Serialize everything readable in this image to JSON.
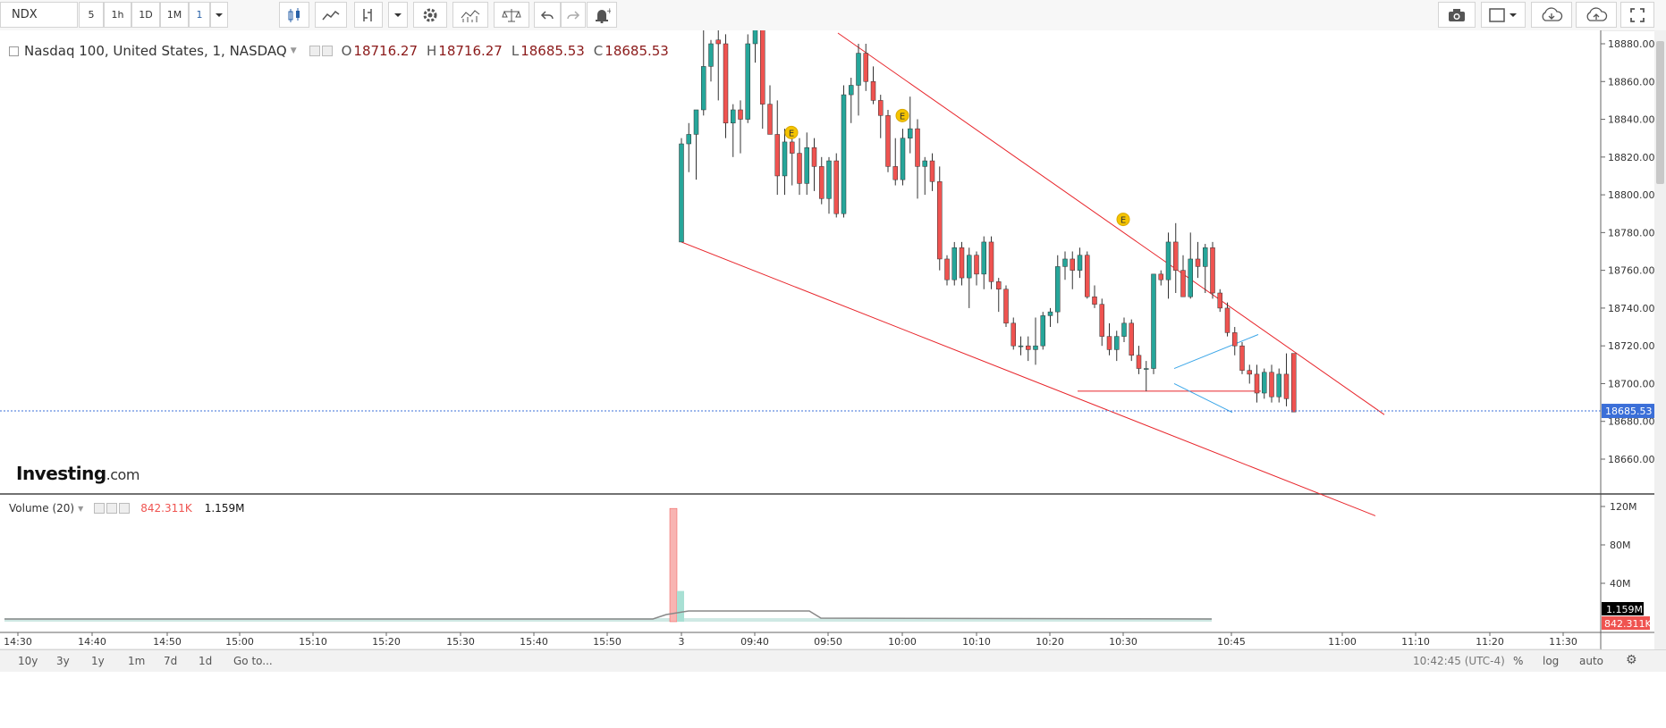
{
  "toolbar": {
    "symbol": "NDX",
    "intervals": [
      "5",
      "1h",
      "1D",
      "1M",
      "1"
    ],
    "active_interval": "1",
    "icons": [
      "candles-icon",
      "line-chart-icon",
      "drawing-tool-icon",
      "dropdown-icon",
      "settings-icon",
      "indicators-icon",
      "compare-icon",
      "undo-icon",
      "redo-icon",
      "alert-icon",
      "camera-icon",
      "layout-icon",
      "cloud-download-icon",
      "cloud-upload-icon",
      "fullscreen-icon"
    ]
  },
  "legend": {
    "name": "Nasdaq 100, United States, 1, NASDAQ",
    "open_label": "O",
    "open": "18716.27",
    "high_label": "H",
    "high": "18716.27",
    "low_label": "L",
    "low": "18685.53",
    "close_label": "C",
    "close": "18685.53"
  },
  "volume_legend": {
    "name": "Volume (20)",
    "value1": "842.311K",
    "value2": "1.159M"
  },
  "logo": {
    "brand": "Investing",
    "domain": ".com"
  },
  "bottom": {
    "ranges": [
      "10y",
      "3y",
      "1y",
      "1m",
      "7d",
      "1d"
    ],
    "goto": "Go to...",
    "time": "10:42:45 (UTC-4)",
    "pct": "%",
    "log": "log",
    "auto": "auto"
  },
  "colors": {
    "up": "#26a69a",
    "down": "#ef5350",
    "trendline": "#e8252b",
    "pattern": "#3ba6e8",
    "priceline": "#3b6fd8"
  },
  "chart_data": {
    "type": "candlestick",
    "ylim": [
      18645,
      18885
    ],
    "y_ticks": [
      18880,
      18860,
      18840,
      18820,
      18800,
      18780,
      18760,
      18740,
      18720,
      18700,
      18680,
      18660
    ],
    "y_tick_labels": [
      "18880.00",
      "18860.00",
      "18840.00",
      "18820.00",
      "18800.00",
      "18780.00",
      "18760.00",
      "18740.00",
      "18720.00",
      "18700.00",
      "18680.00",
      "18660.00"
    ],
    "x_ticks": [
      "14:30",
      "14:40",
      "14:50",
      "15:00",
      "15:10",
      "15:20",
      "15:30",
      "15:40",
      "15:50",
      "3",
      "09:40",
      "09:50",
      "10:00",
      "10:10",
      "10:20",
      "10:30",
      "10:45",
      "11:00",
      "11:10",
      "11:20",
      "11:30"
    ],
    "last_price": "18685.53",
    "earnings_markers": [
      "E",
      "E",
      "E"
    ],
    "candles": [
      {
        "o": 18775,
        "h": 18830,
        "l": 18775,
        "c": 18827
      },
      {
        "o": 18827,
        "h": 18838,
        "l": 18812,
        "c": 18832
      },
      {
        "o": 18832,
        "h": 18845,
        "l": 18808,
        "c": 18845
      },
      {
        "o": 18845,
        "h": 18890,
        "l": 18842,
        "c": 18868
      },
      {
        "o": 18868,
        "h": 18882,
        "l": 18860,
        "c": 18880
      },
      {
        "o": 18882,
        "h": 18890,
        "l": 18850,
        "c": 18880
      },
      {
        "o": 18880,
        "h": 18885,
        "l": 18830,
        "c": 18838
      },
      {
        "o": 18838,
        "h": 18848,
        "l": 18820,
        "c": 18845
      },
      {
        "o": 18845,
        "h": 18850,
        "l": 18822,
        "c": 18840
      },
      {
        "o": 18840,
        "h": 18885,
        "l": 18838,
        "c": 18880
      },
      {
        "o": 18880,
        "h": 18890,
        "l": 18870,
        "c": 18888
      },
      {
        "o": 18888,
        "h": 18892,
        "l": 18835,
        "c": 18848
      },
      {
        "o": 18848,
        "h": 18858,
        "l": 18832,
        "c": 18832
      },
      {
        "o": 18832,
        "h": 18850,
        "l": 18800,
        "c": 18810
      },
      {
        "o": 18810,
        "h": 18835,
        "l": 18800,
        "c": 18828
      },
      {
        "o": 18828,
        "h": 18835,
        "l": 18805,
        "c": 18822
      },
      {
        "o": 18822,
        "h": 18830,
        "l": 18800,
        "c": 18806
      },
      {
        "o": 18806,
        "h": 18833,
        "l": 18800,
        "c": 18825
      },
      {
        "o": 18825,
        "h": 18830,
        "l": 18802,
        "c": 18815
      },
      {
        "o": 18815,
        "h": 18820,
        "l": 18795,
        "c": 18798
      },
      {
        "o": 18798,
        "h": 18820,
        "l": 18790,
        "c": 18818
      },
      {
        "o": 18818,
        "h": 18822,
        "l": 18788,
        "c": 18790
      },
      {
        "o": 18790,
        "h": 18858,
        "l": 18788,
        "c": 18853
      },
      {
        "o": 18853,
        "h": 18862,
        "l": 18838,
        "c": 18858
      },
      {
        "o": 18858,
        "h": 18880,
        "l": 18842,
        "c": 18875
      },
      {
        "o": 18875,
        "h": 18880,
        "l": 18855,
        "c": 18860
      },
      {
        "o": 18860,
        "h": 18868,
        "l": 18848,
        "c": 18850
      },
      {
        "o": 18850,
        "h": 18853,
        "l": 18830,
        "c": 18842
      },
      {
        "o": 18842,
        "h": 18845,
        "l": 18812,
        "c": 18815
      },
      {
        "o": 18815,
        "h": 18830,
        "l": 18805,
        "c": 18808
      },
      {
        "o": 18808,
        "h": 18835,
        "l": 18805,
        "c": 18830
      },
      {
        "o": 18830,
        "h": 18852,
        "l": 18822,
        "c": 18835
      },
      {
        "o": 18835,
        "h": 18840,
        "l": 18798,
        "c": 18815
      },
      {
        "o": 18815,
        "h": 18820,
        "l": 18800,
        "c": 18818
      },
      {
        "o": 18818,
        "h": 18822,
        "l": 18802,
        "c": 18807
      },
      {
        "o": 18807,
        "h": 18815,
        "l": 18760,
        "c": 18766
      },
      {
        "o": 18766,
        "h": 18768,
        "l": 18752,
        "c": 18755
      },
      {
        "o": 18755,
        "h": 18775,
        "l": 18752,
        "c": 18772
      },
      {
        "o": 18772,
        "h": 18775,
        "l": 18752,
        "c": 18756
      },
      {
        "o": 18756,
        "h": 18772,
        "l": 18740,
        "c": 18768
      },
      {
        "o": 18768,
        "h": 18770,
        "l": 18752,
        "c": 18758
      },
      {
        "o": 18758,
        "h": 18778,
        "l": 18750,
        "c": 18775
      },
      {
        "o": 18775,
        "h": 18778,
        "l": 18750,
        "c": 18754
      },
      {
        "o": 18754,
        "h": 18756,
        "l": 18738,
        "c": 18750
      },
      {
        "o": 18750,
        "h": 18752,
        "l": 18730,
        "c": 18732
      },
      {
        "o": 18732,
        "h": 18735,
        "l": 18718,
        "c": 18720
      },
      {
        "o": 18720,
        "h": 18725,
        "l": 18715,
        "c": 18720
      },
      {
        "o": 18720,
        "h": 18725,
        "l": 18712,
        "c": 18718
      },
      {
        "o": 18718,
        "h": 18735,
        "l": 18710,
        "c": 18720
      },
      {
        "o": 18720,
        "h": 18738,
        "l": 18718,
        "c": 18736
      },
      {
        "o": 18736,
        "h": 18740,
        "l": 18730,
        "c": 18738
      },
      {
        "o": 18738,
        "h": 18768,
        "l": 18732,
        "c": 18762
      },
      {
        "o": 18762,
        "h": 18770,
        "l": 18755,
        "c": 18766
      },
      {
        "o": 18766,
        "h": 18770,
        "l": 18750,
        "c": 18760
      },
      {
        "o": 18760,
        "h": 18772,
        "l": 18756,
        "c": 18768
      },
      {
        "o": 18768,
        "h": 18770,
        "l": 18745,
        "c": 18746
      },
      {
        "o": 18746,
        "h": 18752,
        "l": 18740,
        "c": 18742
      },
      {
        "o": 18742,
        "h": 18745,
        "l": 18720,
        "c": 18725
      },
      {
        "o": 18725,
        "h": 18732,
        "l": 18715,
        "c": 18718
      },
      {
        "o": 18718,
        "h": 18728,
        "l": 18712,
        "c": 18725
      },
      {
        "o": 18725,
        "h": 18735,
        "l": 18722,
        "c": 18732
      },
      {
        "o": 18732,
        "h": 18734,
        "l": 18712,
        "c": 18715
      },
      {
        "o": 18715,
        "h": 18720,
        "l": 18705,
        "c": 18708
      },
      {
        "o": 18708,
        "h": 18712,
        "l": 18696,
        "c": 18708
      },
      {
        "o": 18708,
        "h": 18758,
        "l": 18705,
        "c": 18758
      },
      {
        "o": 18758,
        "h": 18760,
        "l": 18752,
        "c": 18755
      },
      {
        "o": 18755,
        "h": 18780,
        "l": 18745,
        "c": 18775
      },
      {
        "o": 18775,
        "h": 18785,
        "l": 18748,
        "c": 18760
      },
      {
        "o": 18760,
        "h": 18768,
        "l": 18746,
        "c": 18746
      },
      {
        "o": 18746,
        "h": 18780,
        "l": 18745,
        "c": 18766
      },
      {
        "o": 18766,
        "h": 18775,
        "l": 18756,
        "c": 18762
      },
      {
        "o": 18762,
        "h": 18774,
        "l": 18748,
        "c": 18772
      },
      {
        "o": 18772,
        "h": 18775,
        "l": 18745,
        "c": 18748
      },
      {
        "o": 18748,
        "h": 18750,
        "l": 18738,
        "c": 18740
      },
      {
        "o": 18740,
        "h": 18743,
        "l": 18725,
        "c": 18727
      },
      {
        "o": 18727,
        "h": 18730,
        "l": 18715,
        "c": 18720
      },
      {
        "o": 18720,
        "h": 18722,
        "l": 18705,
        "c": 18707
      },
      {
        "o": 18707,
        "h": 18710,
        "l": 18700,
        "c": 18705
      },
      {
        "o": 18705,
        "h": 18710,
        "l": 18690,
        "c": 18695
      },
      {
        "o": 18695,
        "h": 18708,
        "l": 18692,
        "c": 18706
      },
      {
        "o": 18706,
        "h": 18710,
        "l": 18690,
        "c": 18693
      },
      {
        "o": 18693,
        "h": 18708,
        "l": 18690,
        "c": 18705
      },
      {
        "o": 18705,
        "h": 18716,
        "l": 18688,
        "c": 18692
      },
      {
        "o": 18716,
        "h": 18716,
        "l": 18685,
        "c": 18685
      }
    ],
    "volume": {
      "ylim": [
        0,
        130
      ],
      "y_ticks": [
        120,
        80,
        40
      ],
      "y_tick_labels": [
        "120M",
        "80M",
        "40M"
      ],
      "spike_down": 118,
      "spike_up": 32,
      "last_up_label": "1.159M",
      "last_down_label": "842.311K"
    }
  }
}
